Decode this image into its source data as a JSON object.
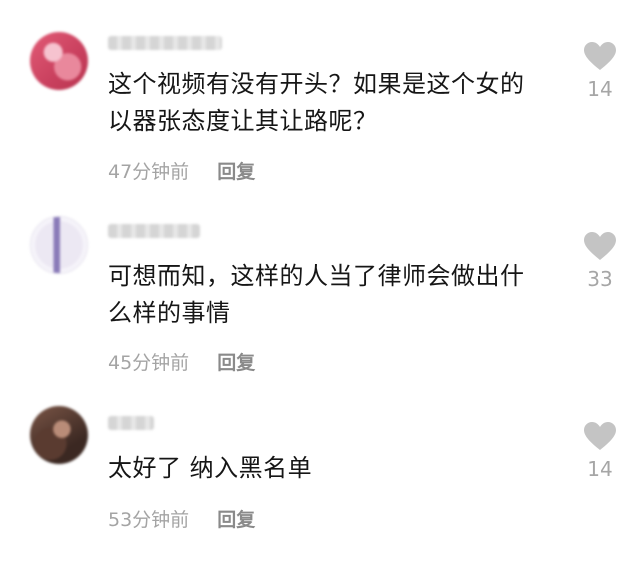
{
  "comments": [
    {
      "text": "这个视频有没有开头？如果是这个女的以器张态度让其让路呢？",
      "time": "47分钟前",
      "reply_label": "回复",
      "likes": "14"
    },
    {
      "text": "可想而知，这样的人当了律师会做出什么样的事情",
      "time": "45分钟前",
      "reply_label": "回复",
      "likes": "33"
    },
    {
      "text": "太好了 纳入黑名单",
      "time": "53分钟前",
      "reply_label": "回复",
      "likes": "14"
    }
  ],
  "icons": {
    "like": "heart-icon"
  },
  "colors": {
    "text": "#161616",
    "meta": "#a4a4a4",
    "reply": "#8a8a8a",
    "heart": "#c4c4c4",
    "background": "#ffffff"
  }
}
